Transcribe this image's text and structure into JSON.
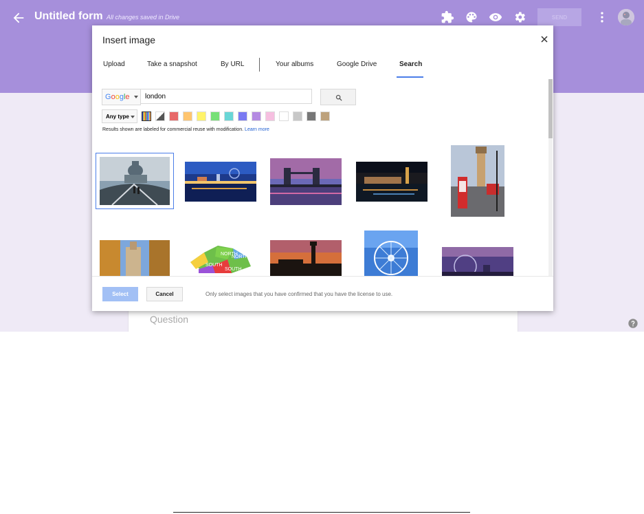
{
  "app": {
    "title": "Untitled form",
    "saved_status": "All changes saved in Drive",
    "send_label": "SEND",
    "question_placeholder": "Question"
  },
  "dialog": {
    "title": "Insert image",
    "tabs": [
      {
        "label": "Upload"
      },
      {
        "label": "Take a snapshot"
      },
      {
        "label": "By URL"
      },
      {
        "label": "Your albums"
      },
      {
        "label": "Google Drive"
      },
      {
        "label": "Search"
      }
    ],
    "active_tab": "Search",
    "search": {
      "provider": "Google",
      "query": "london"
    },
    "type_filter": "Any type",
    "color_swatches": [
      "#ffffff",
      "#666666",
      "#e76969",
      "#ffc56f",
      "#fff36a",
      "#78e078",
      "#69d6d6",
      "#7a7af2",
      "#b48ae2",
      "#f6bfe0",
      "#ffffff",
      "#c7c7c7",
      "#777777",
      "#bda27d"
    ],
    "license_note": "Results shown are labeled for commercial reuse with modification.",
    "learn_more": "Learn more",
    "select_label": "Select",
    "cancel_label": "Cancel",
    "footer_note": "Only select images that you have confirmed that you have the license to use."
  },
  "colors": {
    "header": "#a68fdb",
    "app_bg": "#efeaf6",
    "accent": "#4a7de8"
  },
  "icons": [
    "back-arrow-icon",
    "addon-puzzle-icon",
    "palette-icon",
    "eye-preview-icon",
    "settings-gear-icon",
    "more-vert-icon",
    "avatar",
    "close-icon",
    "search-icon",
    "help-icon"
  ]
}
